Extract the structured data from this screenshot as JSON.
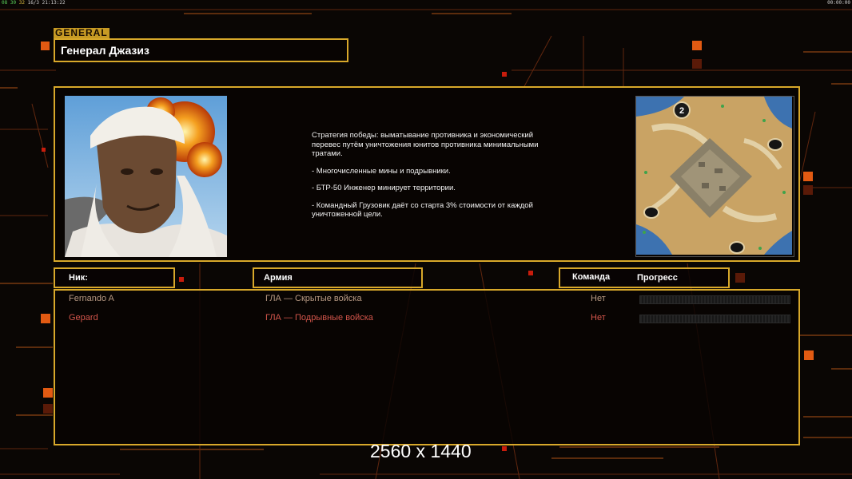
{
  "status_bar": {
    "left_a": "08",
    "left_b": "30",
    "left_c": "32",
    "left_d": "16/3",
    "clock": "21:13:22",
    "right": "00:00:00"
  },
  "general": {
    "tag": "GENERAL",
    "name": "Генерал Джазиз",
    "strategy": "Стратегия победы: выматывание противника и экономический\n перевес путём уничтожения юнитов противника минимальными\n тратами.",
    "bullets": [
      "- Многочисленные мины и подрывники.",
      "- БТР-50 Инженер минирует территории.",
      "- Командный Грузовик даёт со старта 3% стоимости от каждой\n уничтоженной цели."
    ],
    "map_player_marker": "2"
  },
  "columns": {
    "nick": "Ник:",
    "army": "Армия",
    "team": "Команда",
    "progress": "Прогресс"
  },
  "players": [
    {
      "name": "Fernando A",
      "army": "ГЛА — Скрытые войска",
      "team": "Нет",
      "progress": 0,
      "color": "#b89a84"
    },
    {
      "name": "Gepard",
      "army": "ГЛА — Подрывные войска",
      "team": "Нет",
      "progress": 0,
      "color": "#d2554b"
    }
  ],
  "watermark": "2560 x 1440",
  "colors": {
    "accent": "#d8a82a",
    "orange": "#e25a12",
    "background": "#0a0604"
  }
}
